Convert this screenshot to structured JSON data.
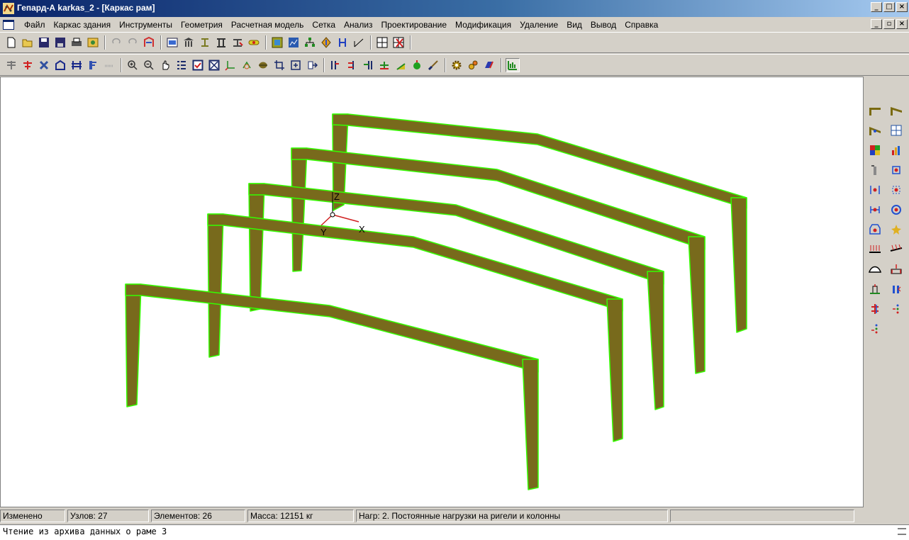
{
  "window": {
    "title": "Гепард-А karkas_2 - [Каркас рам]",
    "app_icon": "gepard-app-icon",
    "controls": [
      "_",
      "□",
      "×"
    ],
    "mdi_controls": [
      "_",
      "▫",
      "×"
    ]
  },
  "menu": {
    "items": [
      "Файл",
      "Каркас здания",
      "Инструменты",
      "Геометрия",
      "Расчетная модель",
      "Сетка",
      "Анализ",
      "Проектирование",
      "Модификация",
      "Удаление",
      "Вид",
      "Вывод",
      "Справка"
    ]
  },
  "toolbar1": {
    "icons": [
      "new-file-icon",
      "open-folder-icon",
      "save-icon",
      "save-as-icon",
      "print-icon",
      "image-icon",
      "undo-icon",
      "redo-icon",
      "frame-wizard-icon",
      "building-icon",
      "columns-icon",
      "i-beam-icon",
      "double-column-icon",
      "section-icon",
      "link-icon",
      "report-icon",
      "chart-icon",
      "hierarchy-icon",
      "diamond-icon",
      "node-icon",
      "angle-icon",
      "grid-icon",
      "delete-grid-icon"
    ]
  },
  "toolbar2": {
    "icons": [
      "add-element-icon",
      "add-red-element-icon",
      "delete-element-icon",
      "frame-view-icon",
      "beam-grid-icon",
      "column-view-icon",
      "hatch-icon",
      "zoom-in-icon",
      "zoom-out-icon",
      "pan-hand-icon",
      "list-icon",
      "select-box-icon",
      "deselect-box-icon",
      "axes-icon",
      "rotate-icon",
      "sphere-icon",
      "crop-icon",
      "fit-icon",
      "move-icon",
      "section-a-icon",
      "section-b-icon",
      "section-c-icon",
      "support-icon",
      "load-icon",
      "bomb-icon",
      "brush-icon",
      "settings-icon",
      "gears-icon",
      "material-icon",
      "results-icon"
    ]
  },
  "right_toolbar": {
    "icons": [
      "beam-icon",
      "sloped-beam-icon",
      "cantilever-icon",
      "panel-grid-icon",
      "color-map-icon",
      "bar-chart-icon",
      "column-label-icon",
      "node-blue-icon",
      "node-left-icon",
      "node-right-icon",
      "node-both-icon",
      "node-ring-icon",
      "node-rect-icon",
      "star-icon",
      "dist-load-icon",
      "dist-load2-icon",
      "arc-icon",
      "point-load-icon",
      "support-load-icon",
      "column-load-icon",
      "load-red-icon",
      "dots-icon",
      "dots2-icon"
    ]
  },
  "axes": {
    "z": "Z",
    "x": "X",
    "y": "Y"
  },
  "status": {
    "modified": "Изменено",
    "nodes": "Узлов: 27",
    "elements": "Элементов: 26",
    "mass": "Масса: 12151 кг",
    "load": "Нагр: 2. Постоянные нагрузки на ригели и колонны",
    "extra": ""
  },
  "output": {
    "line": "Чтение из архива данных о раме 3"
  },
  "colors": {
    "frame_fill": "#786a1c",
    "frame_edge": "#33ff00",
    "titlebar": "#0a246a"
  }
}
